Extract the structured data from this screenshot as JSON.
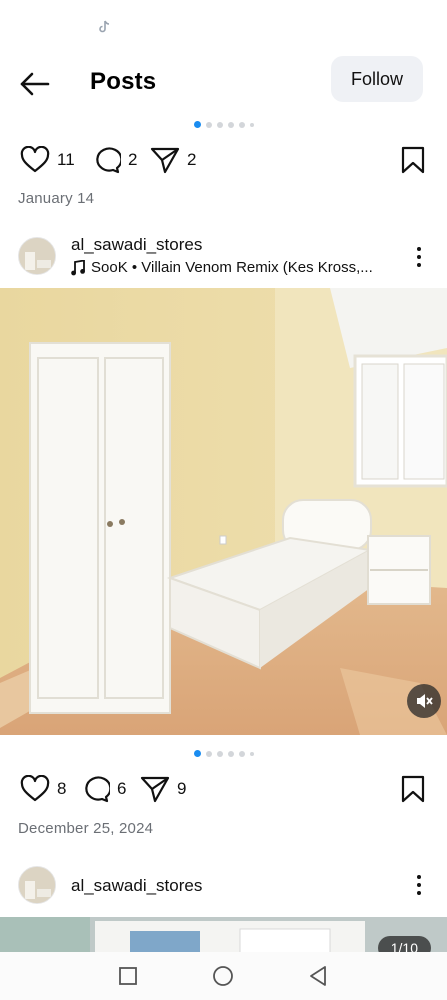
{
  "header": {
    "title": "Posts",
    "follow_label": "Follow"
  },
  "post1_footer": {
    "likes": "11",
    "comments": "2",
    "shares": "2",
    "date": "January 14"
  },
  "post2": {
    "username": "al_sawadi_stores",
    "audio": "SooK • Villain Venom Remix (Kes Kross,...",
    "likes": "8",
    "comments": "6",
    "shares": "9",
    "date": "December 25, 2024"
  },
  "post3": {
    "username": "al_sawadi_stores",
    "counter": "1/10"
  },
  "colors": {
    "accent_dot": "#1a8cf0",
    "follow_bg": "#eff1f5",
    "date_text": "#6b6f75"
  },
  "icons": {
    "back": "arrow-left-icon",
    "like": "heart-icon",
    "comment": "comment-icon",
    "share": "send-icon",
    "save": "bookmark-icon",
    "more": "more-vertical-icon",
    "music": "music-note-icon",
    "mute": "speaker-muted-icon",
    "nav_recents": "square-icon",
    "nav_home": "circle-icon",
    "nav_back": "triangle-back-icon"
  }
}
